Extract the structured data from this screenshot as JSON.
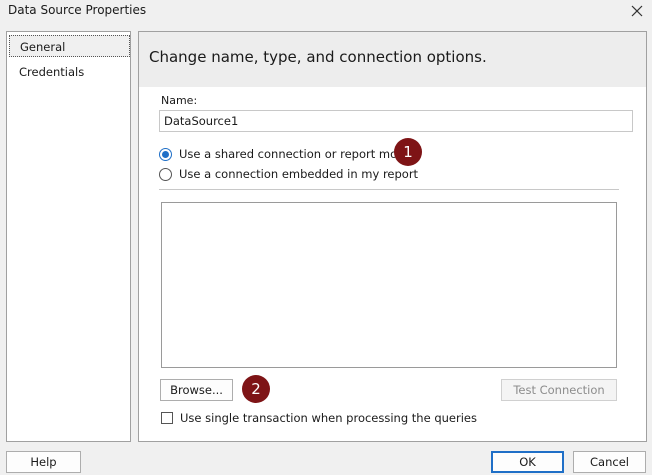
{
  "window": {
    "title": "Data Source Properties",
    "close_icon": "close-icon"
  },
  "nav": {
    "items": [
      {
        "label": "General",
        "selected": true
      },
      {
        "label": "Credentials",
        "selected": false
      }
    ]
  },
  "content": {
    "header": "Change name, type, and connection options.",
    "name_label": "Name:",
    "name_value": "DataSource1",
    "radio_shared_label": "Use a shared connection or report model",
    "radio_embedded_label": "Use a connection embedded in my report",
    "radio_selected": "shared",
    "browse_label": "Browse...",
    "test_connection_label": "Test Connection",
    "single_transaction_label": "Use single transaction when processing the queries",
    "single_transaction_checked": false
  },
  "badges": {
    "first": "1",
    "second": "2",
    "color": "#7e1416"
  },
  "footer": {
    "help_label": "Help",
    "ok_label": "OK",
    "cancel_label": "Cancel"
  },
  "colors": {
    "accent": "#1f6fc7",
    "background": "#f0f0f0",
    "header_band": "#ededed"
  }
}
